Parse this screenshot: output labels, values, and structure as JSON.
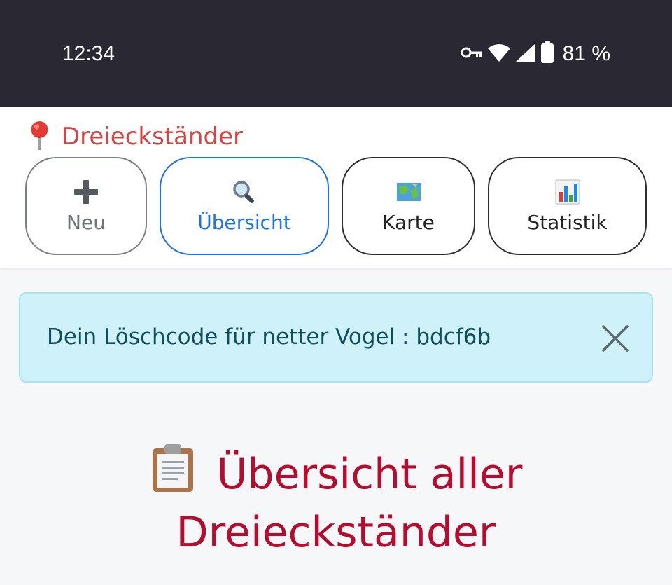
{
  "status_bar": {
    "time": "12:34",
    "battery": "81 %",
    "icons": [
      "vpn-key-icon",
      "wifi-icon",
      "signal-icon",
      "battery-icon"
    ]
  },
  "header": {
    "brand_icon": "location-pin-icon",
    "brand_label": "Dreieckständer",
    "nav": [
      {
        "label": "Neu",
        "icon": "plus-icon"
      },
      {
        "label": "Übersicht",
        "icon": "magnifier-icon"
      },
      {
        "label": "Karte",
        "icon": "map-icon"
      },
      {
        "label": "Statistik",
        "icon": "bar-chart-icon"
      }
    ]
  },
  "alert": {
    "message": "Dein Löschcode für netter Vogel : bdcf6b",
    "close_icon": "close-icon"
  },
  "main": {
    "title_icon": "clipboard-icon",
    "title_line1": "Übersicht aller",
    "title_line2": "Dreieckständer"
  },
  "colors": {
    "status_bar_bg": "#2a2933",
    "brand": "#d64545",
    "active_nav": "#1a73e8",
    "alert_bg": "#cff1fa",
    "alert_text": "#0f4f5c",
    "heading": "#b50d2f"
  }
}
